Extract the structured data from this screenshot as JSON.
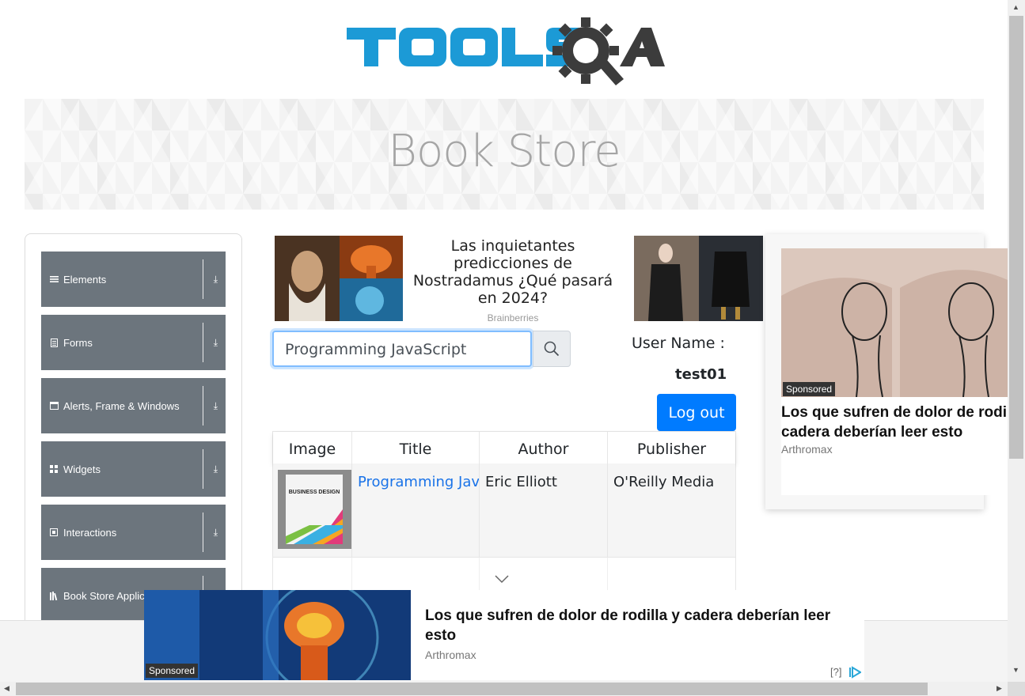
{
  "header": {
    "logo_text": "TOOLSQA",
    "banner_title": "Book Store"
  },
  "sidebar": {
    "items": [
      {
        "label": "Elements",
        "icon": "menu-lines-icon"
      },
      {
        "label": "Forms",
        "icon": "form-doc-icon"
      },
      {
        "label": "Alerts, Frame & Windows",
        "icon": "window-icon"
      },
      {
        "label": "Widgets",
        "icon": "grid-icon"
      },
      {
        "label": "Interactions",
        "icon": "interaction-icon"
      },
      {
        "label": "Book Store Application",
        "icon": "books-icon"
      }
    ],
    "expand_icon": "download-arrow-icon"
  },
  "ads": {
    "top_left": {
      "title": "Las inquietantes predicciones de Nostradamus ¿Qué pasará en 2024?",
      "source": "Brainberries"
    },
    "right_card": {
      "badge": "Sponsored",
      "title_line1": "Los que sufren de dolor de rodilla y",
      "title_line2": "cadera deberían leer esto",
      "source": "Arthromax"
    },
    "bottom": {
      "badge": "Sponsored",
      "title": "Los que sufren de dolor de rodilla y cadera deberían leer esto",
      "source": "Arthromax",
      "help": "[?]"
    }
  },
  "search": {
    "value": "Programming JavaScript",
    "button_icon": "search-icon"
  },
  "user": {
    "label": "User Name :",
    "value": "test01",
    "logout_label": "Log out"
  },
  "table": {
    "headers": [
      "Image",
      "Title",
      "Author",
      "Publisher"
    ],
    "rows": [
      {
        "title": "Programming JavaScript Applications",
        "author": "Eric Elliott",
        "publisher": "O'Reilly Media",
        "cover_text": "BUSINESS DESIGN"
      }
    ]
  },
  "colors": {
    "primary": "#007bff",
    "sidebar_item": "#6c757d",
    "logo_blue": "#1c9ad6",
    "logo_dark": "#3c3c3c"
  }
}
